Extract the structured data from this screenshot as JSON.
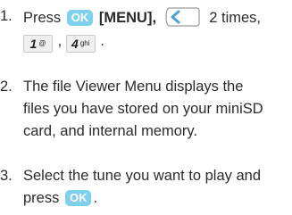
{
  "steps": [
    {
      "number": "1.",
      "line1_text_a": "Press",
      "ok_key": "OK",
      "menu_key": "[MENU],",
      "times": "2 times,",
      "key_1_digit": "1",
      "key_1_sub": "@",
      "key_4_digit": "4",
      "key_4_sub": "ghi",
      "comma": ",",
      "period": "."
    },
    {
      "number": "2.",
      "lines": [
        "The file Viewer Menu displays the",
        "files you have stored on your miniSD",
        "card, and internal memory."
      ]
    },
    {
      "number": "3.",
      "lines": [
        "Select the tune you want to play and",
        "press"
      ],
      "ok_key": "OK",
      "period": "."
    }
  ],
  "colors": {
    "ok_key_bg": "#7fd0ee",
    "nav_key_arrow": "#4a9fd6",
    "text": "#2b2b2b"
  }
}
